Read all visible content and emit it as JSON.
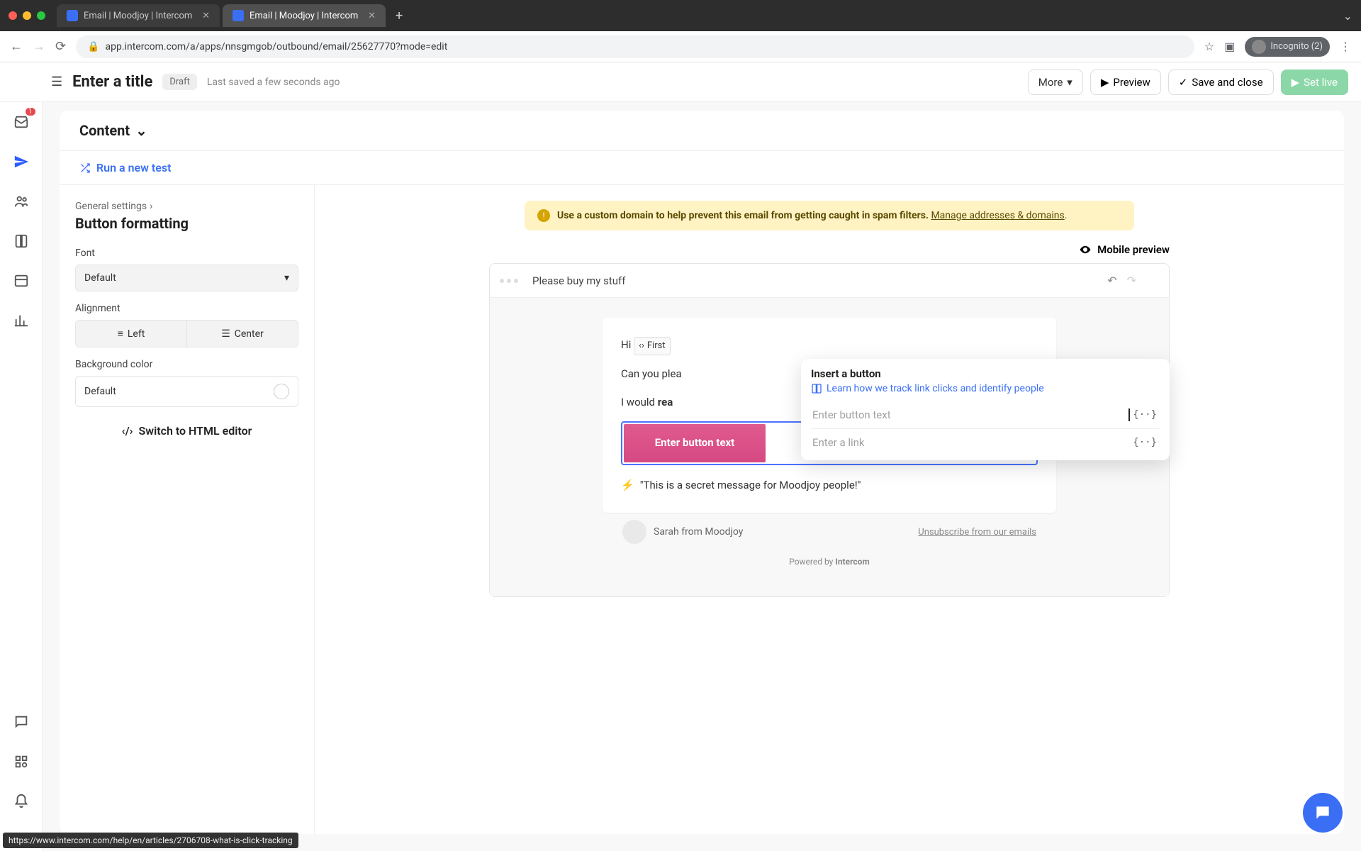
{
  "browser": {
    "tabs": [
      {
        "title": "Email | Moodjoy | Intercom"
      },
      {
        "title": "Email | Moodjoy | Intercom"
      }
    ],
    "url": "app.intercom.com/a/apps/nnsgmgob/outbound/email/25627770?mode=edit",
    "incognito": "Incognito (2)"
  },
  "header": {
    "title": "Enter a title",
    "draft": "Draft",
    "saved": "Last saved a few seconds ago",
    "more": "More",
    "preview": "Preview",
    "save": "Save and close",
    "setlive": "Set live"
  },
  "rail": {
    "inbox_badge": "1"
  },
  "content": {
    "section": "Content",
    "run_test": "Run a new test"
  },
  "settings": {
    "breadcrumb": "General settings",
    "panel": "Button formatting",
    "font_label": "Font",
    "font_value": "Default",
    "align_label": "Alignment",
    "align_left": "Left",
    "align_center": "Center",
    "bg_label": "Background color",
    "bg_value": "Default",
    "html_editor": "Switch to HTML editor"
  },
  "warning": {
    "text": "Use a custom domain to help prevent this email from getting caught in spam filters. ",
    "link": "Manage addresses & domains"
  },
  "mobile_preview": "Mobile preview",
  "email": {
    "subject": "Please buy my stuff",
    "line1_prefix": "Hi ",
    "token": "First",
    "line2": "Can you plea",
    "line3_prefix": "I would ",
    "line3_bold": "rea",
    "cta": "Enter button text",
    "secret": "\"This is a secret message for Moodjoy people!\"",
    "sender": "Sarah from Moodjoy",
    "unsubscribe": "Unsubscribe from our emails",
    "powered_prefix": "Powered by ",
    "powered_brand": "Intercom"
  },
  "popover": {
    "title": "Insert a button",
    "help": "Learn how we track link clicks and identify people",
    "text_placeholder": "Enter button text",
    "link_placeholder": "Enter a link"
  },
  "status_url": "https://www.intercom.com/help/en/articles/2706708-what-is-click-tracking"
}
